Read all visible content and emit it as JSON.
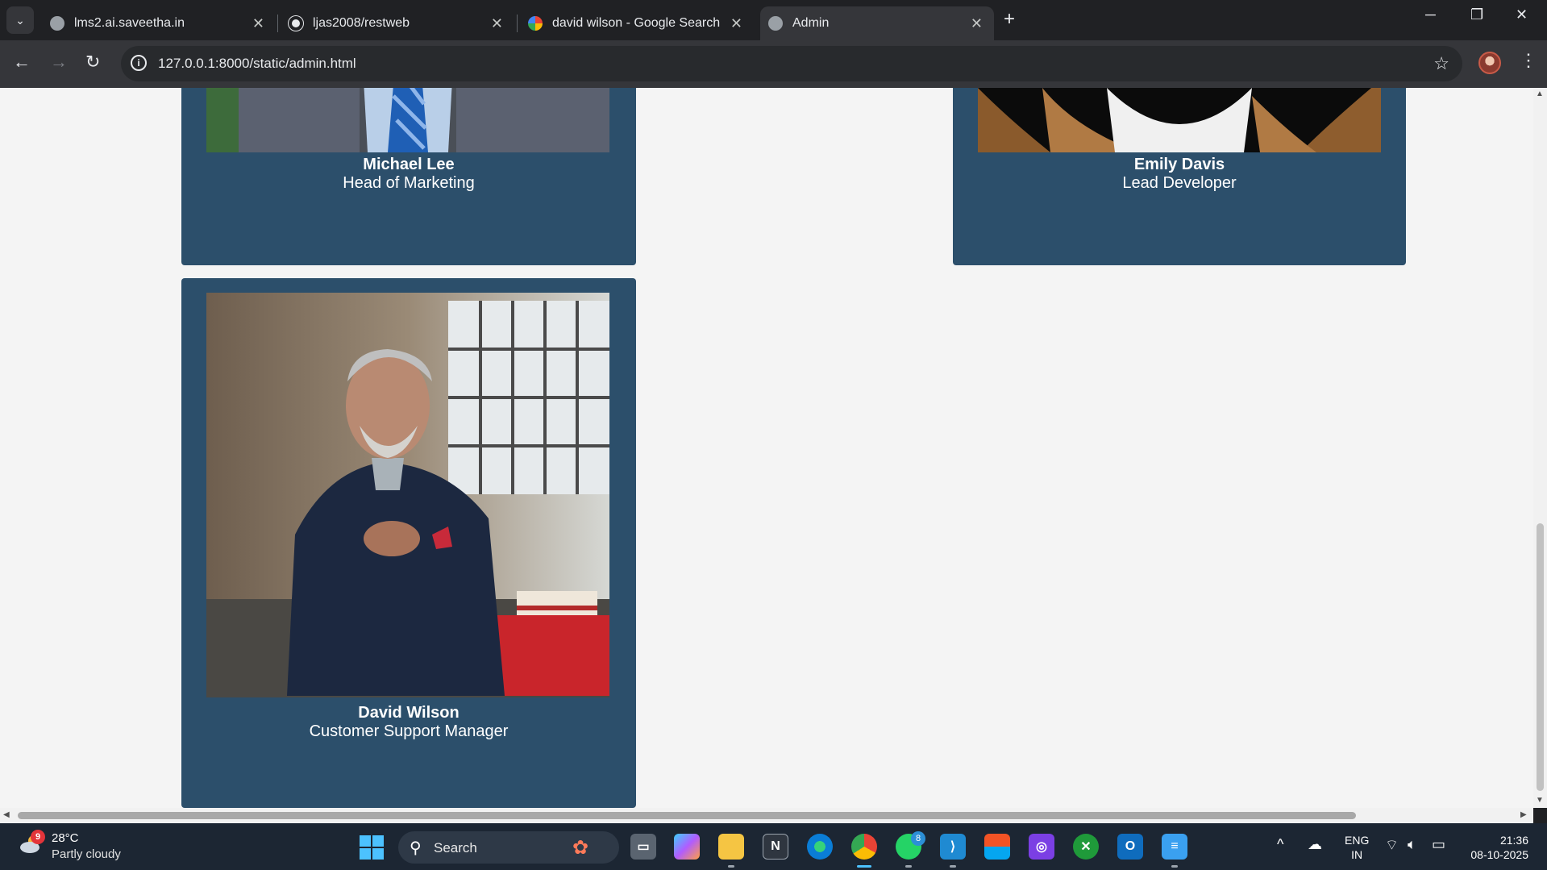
{
  "browser": {
    "tabs": [
      {
        "title": "lms2.ai.saveetha.in",
        "favicon": "globe-icon",
        "active": false
      },
      {
        "title": "ljas2008/restweb",
        "favicon": "github-icon",
        "active": false
      },
      {
        "title": "david wilson - Google Search",
        "favicon": "google-icon",
        "active": false
      },
      {
        "title": "Admin",
        "favicon": "globe-icon",
        "active": true
      }
    ],
    "url": "127.0.0.1:8000/static/admin.html"
  },
  "page": {
    "cards": [
      {
        "name": "Michael Lee",
        "role": "Head of Marketing"
      },
      {
        "name": "Emily Davis",
        "role": "Lead Developer"
      },
      {
        "name": "David Wilson",
        "role": "Customer Support Manager"
      }
    ]
  },
  "taskbar": {
    "weather": {
      "temp": "28°C",
      "desc": "Partly cloudy",
      "badge": "9"
    },
    "search_label": "Search",
    "whatsapp_badge": "8",
    "lang": {
      "line1": "ENG",
      "line2": "IN"
    },
    "clock": {
      "time": "21:36",
      "date": "08-10-2025"
    }
  },
  "colors": {
    "card_bg": "#2c4f6b",
    "page_bg": "#f4f4f4",
    "accent": "#4cc2ff"
  }
}
